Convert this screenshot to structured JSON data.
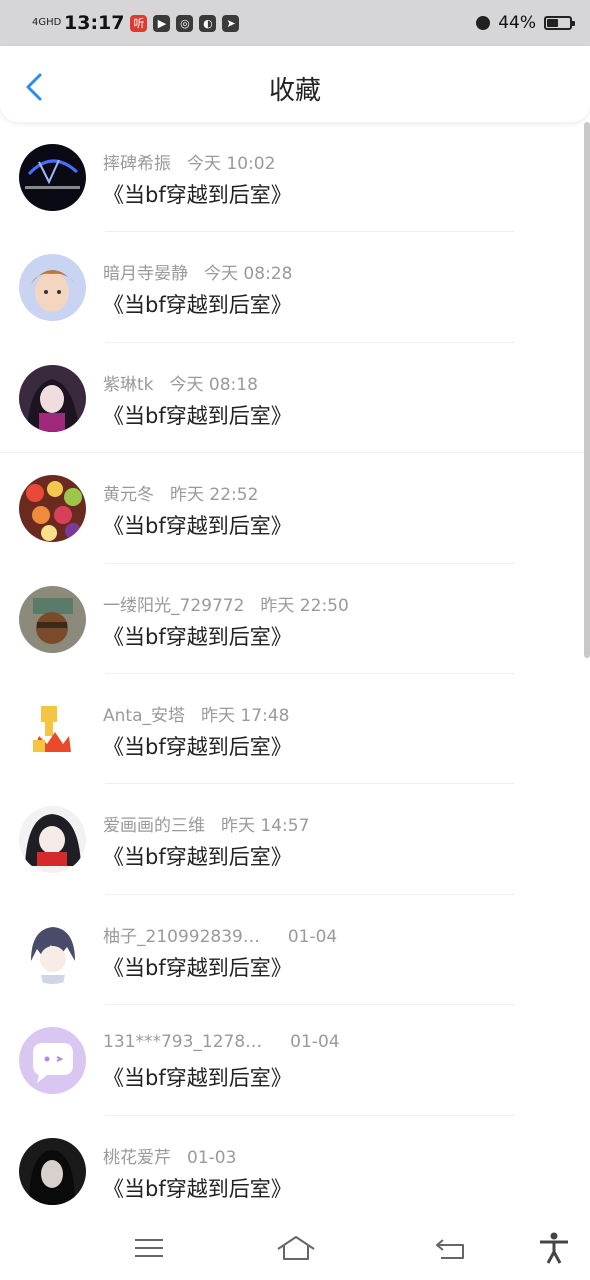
{
  "status_bar": {
    "network": "4GHD",
    "time": "13:17",
    "app_icon_label": "听",
    "battery_percent": "44%",
    "battery_level": 0.44
  },
  "header": {
    "title": "收藏"
  },
  "items": [
    {
      "user": "摔碑希振",
      "time": "今天 10:02",
      "comment": "《当bf穿越到后室》"
    },
    {
      "user": "暗月寺晏静",
      "time": "今天 08:28",
      "comment": "《当bf穿越到后室》"
    },
    {
      "user": "紫琳tk",
      "time": "今天 08:18",
      "comment": "《当bf穿越到后室》"
    },
    {
      "user": "黄元冬",
      "time": "昨天 22:52",
      "comment": "《当bf穿越到后室》"
    },
    {
      "user": "一缕阳光_729772",
      "time": "昨天 22:50",
      "comment": "《当bf穿越到后室》"
    },
    {
      "user": "Anta_安塔",
      "time": "昨天 17:48",
      "comment": "《当bf穿越到后室》"
    },
    {
      "user": "爱画画的三维",
      "time": "昨天 14:57",
      "comment": "《当bf穿越到后室》"
    },
    {
      "user": "柚子_210992839…",
      "time": "01-04",
      "comment": "《当bf穿越到后室》"
    },
    {
      "user": "131***793_1278…",
      "time": "01-04",
      "comment": "《当bf穿越到后室》"
    },
    {
      "user": "桃花爱芹",
      "time": "01-03",
      "comment": "《当bf穿越到后室》"
    }
  ],
  "colors": {
    "accent": "#2b8cf0",
    "muted_text": "#9a9a9a"
  },
  "icons": {
    "back": "chevron-left-icon",
    "menu": "menu-icon",
    "home": "home-icon",
    "return": "return-icon",
    "accessibility": "accessibility-icon"
  }
}
